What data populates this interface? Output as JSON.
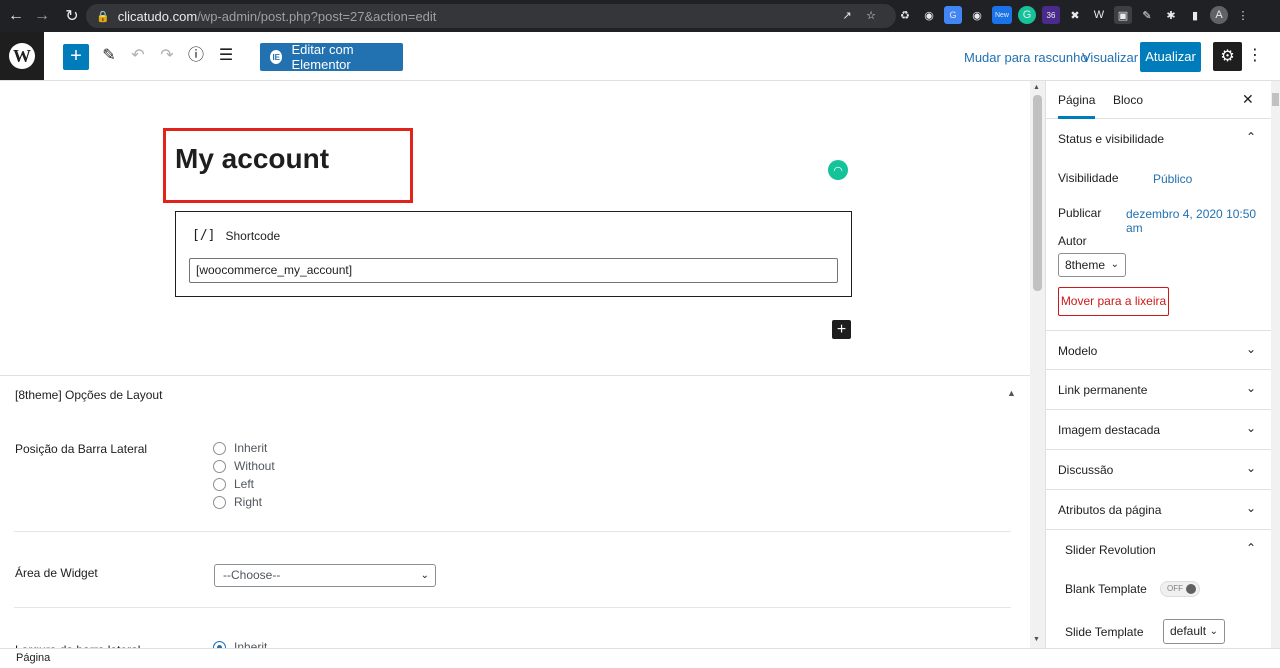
{
  "browser": {
    "url_domain": "clicatudo.com",
    "url_path": "/wp-admin/post.php?post=27&action=edit",
    "ext_badge_new": "New",
    "ext_badge_36": "36",
    "profile_initial": "A"
  },
  "toolbar": {
    "add_label": "+",
    "elementor_icon": "IE",
    "elementor_label": "Editar com Elementor",
    "switch_draft_label": "Mudar para rascunho",
    "preview_label": "Visualizar",
    "update_label": "Atualizar"
  },
  "editor": {
    "post_title": "My account",
    "shortcode_block": {
      "icon": "[/]",
      "label": "Shortcode",
      "value": "[woocommerce_my_account]"
    },
    "append_label": "+"
  },
  "metabox": {
    "title": "[8theme] Opções de Layout",
    "sidebar_position": {
      "label": "Posição da Barra Lateral",
      "options": [
        "Inherit",
        "Without",
        "Left",
        "Right"
      ]
    },
    "widget_area": {
      "label": "Área de Widget",
      "selected": "--Choose--"
    },
    "partial_row": {
      "label": "Largura da barra lateral",
      "option": "Inherit"
    }
  },
  "sidebar": {
    "tabs": [
      "Página",
      "Bloco"
    ],
    "status_panel": {
      "title": "Status e visibilidade",
      "visibility_label": "Visibilidade",
      "visibility_value": "Público",
      "publish_label": "Publicar",
      "publish_value": "dezembro 4, 2020 10:50 am",
      "author_label": "Autor",
      "author_value": "8theme",
      "trash_label": "Mover para a lixeira"
    },
    "panels": [
      "Modelo",
      "Link permanente",
      "Imagem destacada",
      "Discussão",
      "Atributos da página"
    ],
    "slider_revolution": {
      "title": "Slider Revolution",
      "blank_template_label": "Blank Template",
      "toggle_state": "OFF",
      "slide_template_label": "Slide Template",
      "slide_template_value": "default"
    }
  },
  "footer": {
    "breadcrumb": "Página"
  }
}
